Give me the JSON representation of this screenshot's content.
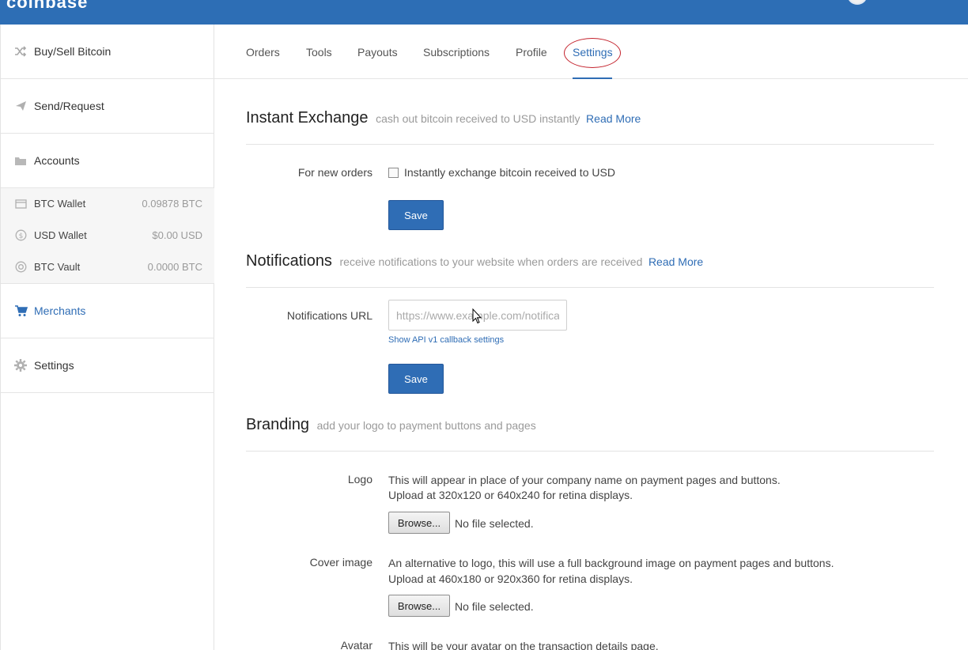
{
  "topbar": {
    "logo": "coinbase",
    "colors": {
      "brand": "#2d6eb5"
    }
  },
  "sidebar": {
    "items": [
      {
        "label": "Buy/Sell Bitcoin",
        "icon": "shuffle-icon"
      },
      {
        "label": "Send/Request",
        "icon": "paper-plane-icon"
      },
      {
        "label": "Accounts",
        "icon": "folder-icon"
      },
      {
        "label": "Merchants",
        "icon": "cart-icon"
      },
      {
        "label": "Settings",
        "icon": "gear-icon"
      }
    ],
    "accounts": [
      {
        "name": "BTC Wallet",
        "balance": "0.09878 BTC",
        "icon": "wallet-icon"
      },
      {
        "name": "USD Wallet",
        "balance": "$0.00 USD",
        "icon": "dollar-coin-icon"
      },
      {
        "name": "BTC Vault",
        "balance": "0.0000 BTC",
        "icon": "vault-icon"
      }
    ],
    "active": "Merchants"
  },
  "tabs": [
    "Orders",
    "Tools",
    "Payouts",
    "Subscriptions",
    "Profile",
    "Settings"
  ],
  "active_tab": "Settings",
  "instant_exchange": {
    "title": "Instant Exchange",
    "subtitle": "cash out bitcoin received to USD instantly",
    "read_more": "Read More",
    "field_label": "For new orders",
    "checkbox_label": "Instantly exchange bitcoin received to USD",
    "checked": false,
    "save_label": "Save"
  },
  "notifications": {
    "title": "Notifications",
    "subtitle": "receive notifications to your website when orders are received",
    "read_more": "Read More",
    "field_label": "Notifications URL",
    "placeholder": "https://www.example.com/notifications",
    "api_link": "Show API v1 callback settings",
    "save_label": "Save"
  },
  "branding": {
    "title": "Branding",
    "subtitle": "add your logo to payment buttons and pages",
    "logo": {
      "label": "Logo",
      "line1": "This will appear in place of your company name on payment pages and buttons.",
      "line2": "Upload at 320x120 or 640x240 for retina displays.",
      "browse": "Browse...",
      "file": "No file selected."
    },
    "cover": {
      "label": "Cover image",
      "line1": "An alternative to logo, this will use a full background image on payment pages and buttons.",
      "line2": "Upload at 460x180 or 920x360 for retina displays.",
      "browse": "Browse...",
      "file": "No file selected."
    },
    "avatar": {
      "label": "Avatar",
      "line1": "This will be your avatar on the transaction details page."
    }
  }
}
